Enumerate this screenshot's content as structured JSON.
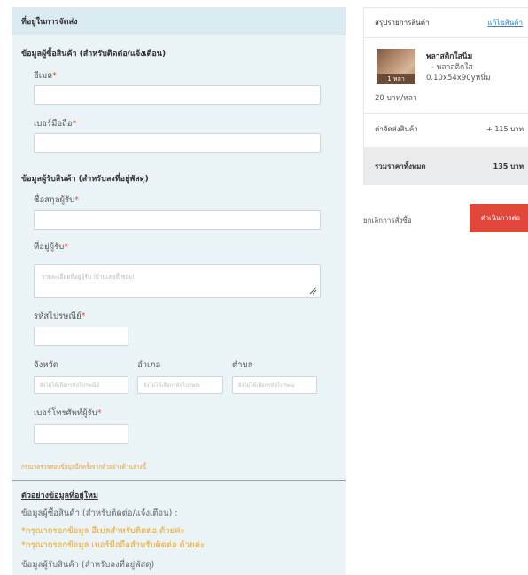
{
  "shipping": {
    "header": "ที่อยู่ในการจัดส่ง",
    "buyer_section": "ข้อมูลผู้ซื้อสินค้า (สำหรับติดต่อ/แจ้งเตือน)",
    "email_label": "อีเมล",
    "phone_label": "เบอร์มือถือ",
    "receiver_section": "ข้อมูลผู้รับสินค้า (สำหรับลงที่อยู่พัสดุ)",
    "name_label": "ชื่อสกุลผู้รับ",
    "address_label": "ที่อยู่ผู้รับ",
    "address_placeholder": "รายละเอียดที่อยู่ผู้รับ (บ้านเลขที่,ซอย)",
    "postcode_label": "รหัสไปรษณีย์",
    "province_label": "จังหวัด",
    "district_label": "อำเภอ",
    "subdistrict_label": "ตำบล",
    "province_placeholder": "ยังไม่ได้เลือกรหัสไปรษณีย์",
    "district_placeholder": "ยังไม่ได้เลือกรหัสไปรษณ",
    "subdistrict_placeholder": "ยังไม่ได้เลือกรหัสไปรษณ",
    "receiver_phone_label": "เบอร์โทรศัพท์ผู้รับ",
    "required_mark": "*",
    "verify_note": "กรุณาตรวจสอบข้อมูลอีกครั้งจากตัวอย่างด้านล่างนี้"
  },
  "example": {
    "title": "ตัวอย่างข้อมูลที่อยู่ใหม่",
    "buyer_line": "ข้อมูลผู้ซื้อสินค้า (สำหรับติดต่อ/แจ้งเตือน) :",
    "warn_email": "*กรุณากรอกข้อมูล อีเมลสำหรับติดต่อ ด้วยค่ะ",
    "warn_phone": "*กรุณากรอกข้อมูล เบอร์มือถือสำหรับติดต่อ ด้วยค่ะ",
    "receiver_line": "ข้อมูลผู้รับสินค้า (สำหรับลงที่อยู่พัสดุ)"
  },
  "summary": {
    "title": "สรุปรายการสินค้า",
    "edit_link": "แก้ไขสินค้า",
    "product": {
      "name": "พลาสติกใสนิ่ม",
      "variant": "- พลาสติกใส",
      "size": "0.10x54x90yหนิ่ม",
      "qty_badge": "1 หลา",
      "unit_price": "20 บาท/หลา"
    },
    "shipping_label": "ค่าจัดส่งสินค้า",
    "shipping_value": "+ 115 บาท",
    "total_label": "รวมราคาทั้งหมด",
    "total_value": "135 บาท"
  },
  "actions": {
    "cancel": "ยกเลิกการสั่งซื้อ",
    "proceed": "ดำเนินการต่อ"
  },
  "colors": {
    "panel_bg": "#eaf4f7",
    "required": "#e24b3b",
    "warning": "#f0a21e",
    "proceed_bg": "#e1463a",
    "link": "#2a7fd4"
  }
}
